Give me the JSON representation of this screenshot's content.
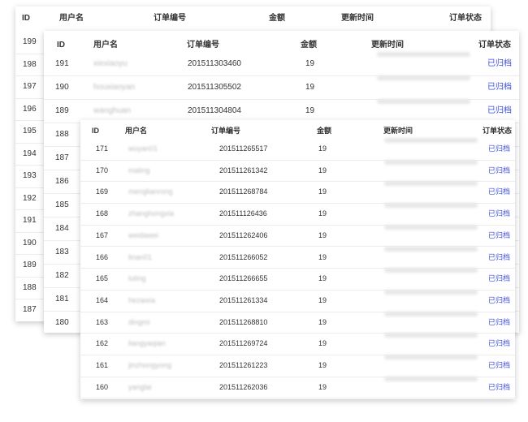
{
  "headers": {
    "id": "ID",
    "username": "用户名",
    "order_no": "订单编号",
    "amount": "金额",
    "updated": "更新时间",
    "status": "订单状态"
  },
  "panel_back": {
    "ids": [
      "199",
      "198",
      "197",
      "196",
      "195",
      "194",
      "193",
      "192",
      "191",
      "190",
      "189",
      "188",
      "187"
    ]
  },
  "panel_middle": {
    "rows": [
      {
        "id": "191",
        "name": "xiexiaoyu",
        "order": "201511303460",
        "amount": "19",
        "status": "已归档"
      },
      {
        "id": "190",
        "name": "houxiaoyan",
        "order": "201511305502",
        "amount": "19",
        "status": "已归档"
      },
      {
        "id": "189",
        "name": "wanghuan",
        "order": "201511304804",
        "amount": "19",
        "status": "已归档"
      }
    ],
    "ids": [
      "188",
      "187",
      "186",
      "185",
      "184",
      "183",
      "182",
      "181",
      "180"
    ]
  },
  "panel_front": {
    "rows": [
      {
        "id": "171",
        "name": "wuyan01",
        "order": "201511265517",
        "amount": "19",
        "status": "已归档"
      },
      {
        "id": "170",
        "name": "maling",
        "order": "201511261342",
        "amount": "19",
        "status": "已归档"
      },
      {
        "id": "169",
        "name": "menglianrong",
        "order": "201511268784",
        "amount": "19",
        "status": "已归档"
      },
      {
        "id": "168",
        "name": "zhanghongxia",
        "order": "201511126436",
        "amount": "19",
        "status": "已归档"
      },
      {
        "id": "167",
        "name": "weidawei",
        "order": "201511262406",
        "amount": "19",
        "status": "已归档"
      },
      {
        "id": "166",
        "name": "linan01",
        "order": "201511266052",
        "amount": "19",
        "status": "已归档"
      },
      {
        "id": "165",
        "name": "luting",
        "order": "201511266655",
        "amount": "19",
        "status": "已归档"
      },
      {
        "id": "164",
        "name": "hezaixia",
        "order": "201511261334",
        "amount": "19",
        "status": "已归档"
      },
      {
        "id": "163",
        "name": "dingmi",
        "order": "201511268810",
        "amount": "19",
        "status": "已归档"
      },
      {
        "id": "162",
        "name": "liangyaqian",
        "order": "201511269724",
        "amount": "19",
        "status": "已归档"
      },
      {
        "id": "161",
        "name": "jinzhongyong",
        "order": "201511261223",
        "amount": "19",
        "status": "已归档"
      },
      {
        "id": "160",
        "name": "yanglai",
        "order": "201511262036",
        "amount": "19",
        "status": "已归档"
      }
    ]
  }
}
